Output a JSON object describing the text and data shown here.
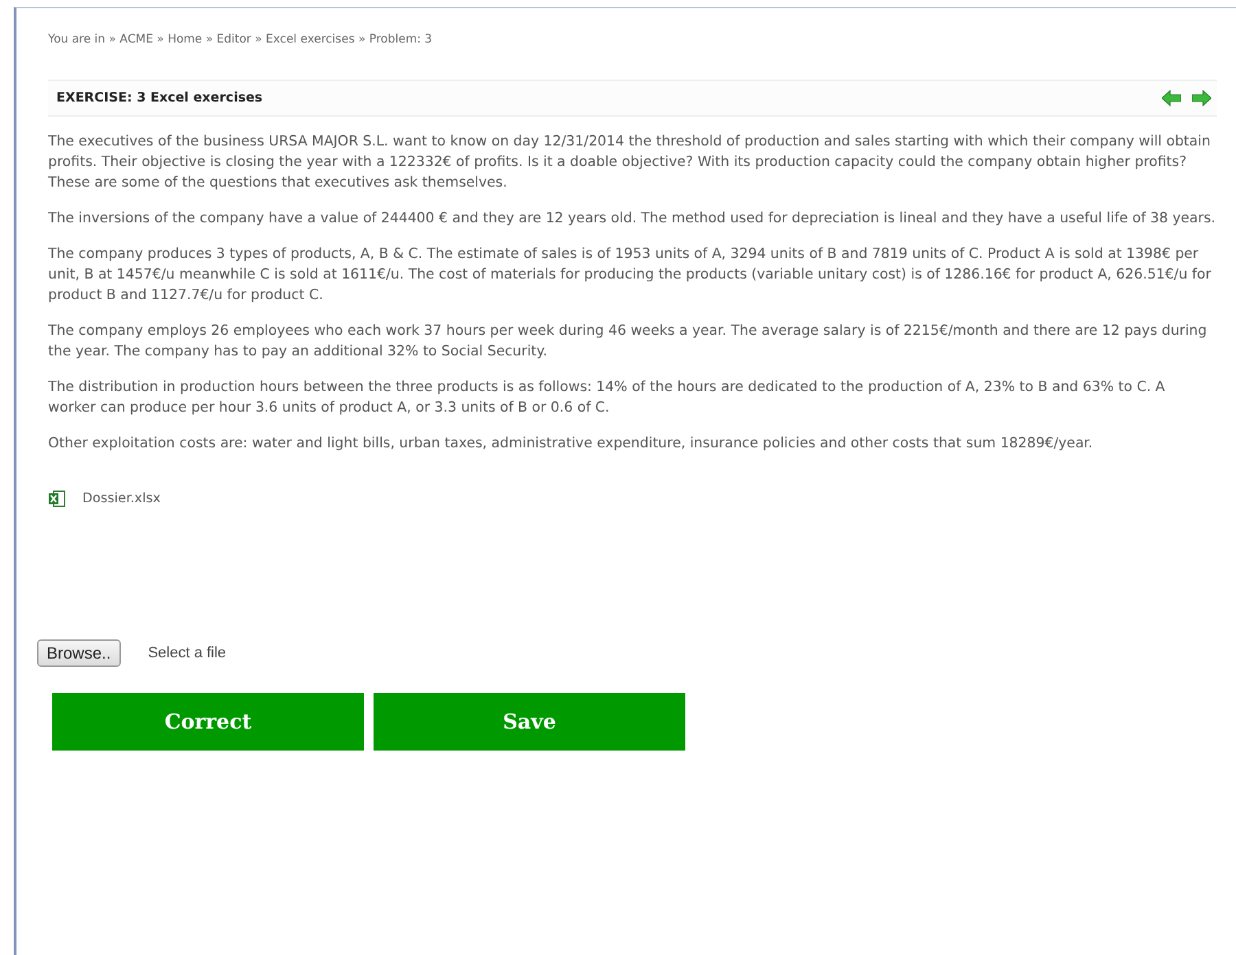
{
  "breadcrumb": "You are in » ACME » Home » Editor » Excel exercises » Problem: 3",
  "exercise": {
    "title": "EXERCISE: 3 Excel exercises"
  },
  "paragraphs": [
    "The executives of the business URSA MAJOR S.L. want to know on day 12/31/2014 the threshold of production and sales starting with which their company will obtain profits. Their objective is closing the year with a 122332€ of profits. Is it a doable objective? With its production capacity could the company obtain higher profits? These are some of the questions that executives ask themselves.",
    "The inversions of the company have a value of 244400 € and they are 12 years old. The method used for depreciation is lineal and they have a useful life of 38 years.",
    "The company produces 3 types of products, A, B & C. The estimate of sales is of 1953 units of A, 3294 units of B and 7819 units of C. Product A is sold at 1398€ per unit, B at 1457€/u meanwhile C is sold at 1611€/u. The cost of materials for producing the products (variable unitary cost) is of 1286.16€ for product A, 626.51€/u for product B and 1127.7€/u for product C.",
    "The company employs 26 employees who each work 37 hours per week during 46 weeks a year. The average salary is of 2215€/month and there are 12 pays during the year. The company has to pay an additional 32% to Social Security.",
    "The distribution in production hours between the three products is as follows: 14% of the hours are dedicated to the production of A, 23% to B and 63% to C. A worker can produce per hour 3.6 units of product A, or 3.3 units of B or 0.6 of C.",
    "Other exploitation costs are: water and light bills, urban taxes, administrative expenditure, insurance policies and other costs that sum 18289€/year."
  ],
  "attachment": "Dossier.xlsx",
  "upload": {
    "button": "Browse..",
    "status": "Select a file"
  },
  "buttons": [
    "Correct",
    "Save"
  ]
}
